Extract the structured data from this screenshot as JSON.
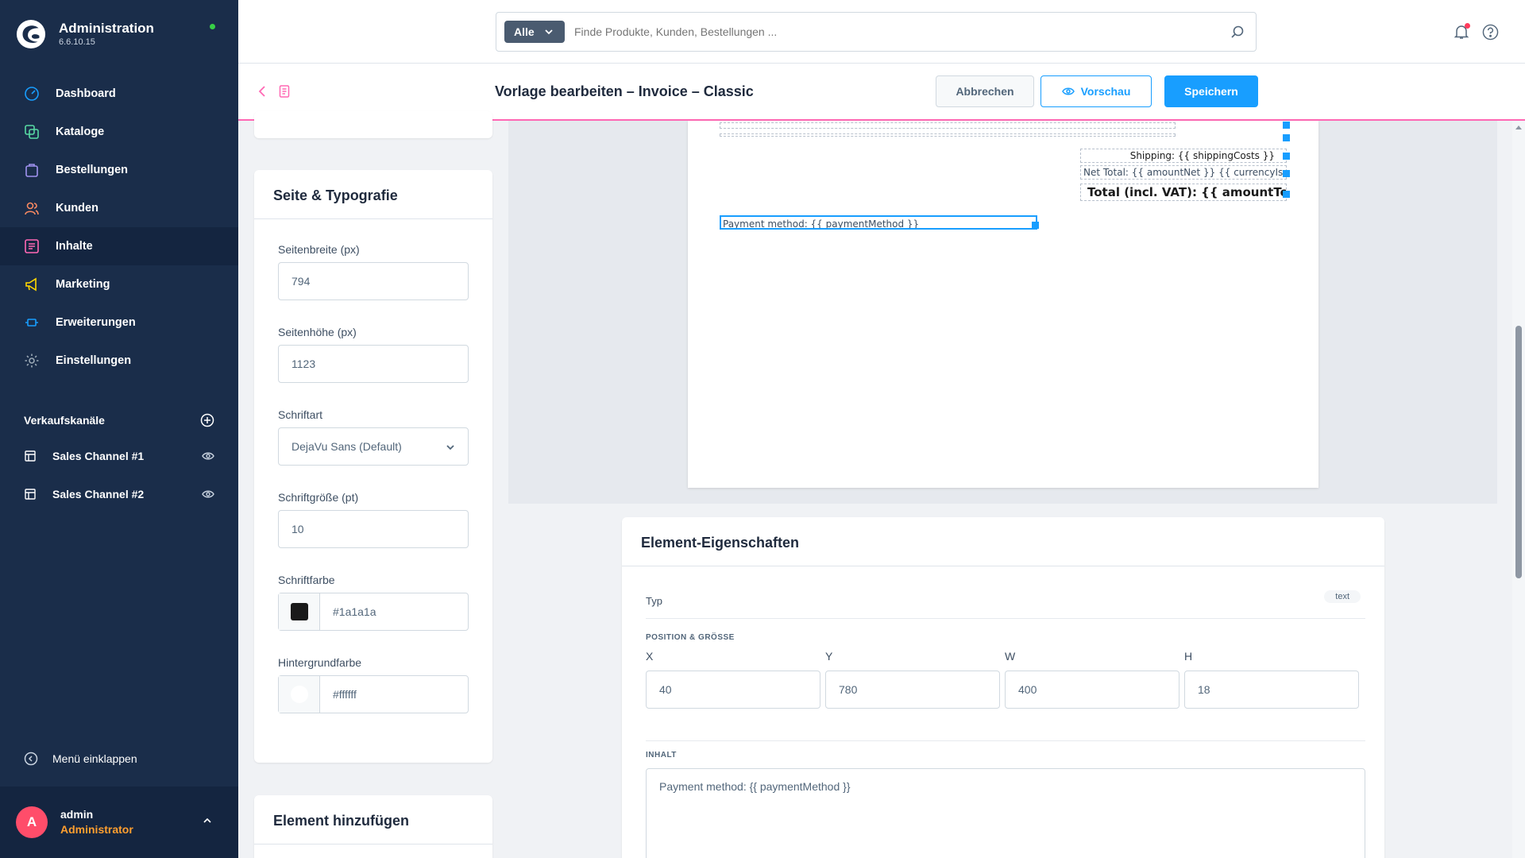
{
  "app": {
    "title": "Administration",
    "version": "6.6.10.15"
  },
  "nav": [
    {
      "label": "Dashboard",
      "icon": "dashboard-icon",
      "active": false
    },
    {
      "label": "Kataloge",
      "icon": "catalog-icon",
      "active": false
    },
    {
      "label": "Bestellungen",
      "icon": "orders-icon",
      "active": false
    },
    {
      "label": "Kunden",
      "icon": "customers-icon",
      "active": false
    },
    {
      "label": "Inhalte",
      "icon": "content-icon",
      "active": true
    },
    {
      "label": "Marketing",
      "icon": "marketing-icon",
      "active": false
    },
    {
      "label": "Erweiterungen",
      "icon": "extensions-icon",
      "active": false
    },
    {
      "label": "Einstellungen",
      "icon": "settings-icon",
      "active": false
    }
  ],
  "sales_channels": {
    "title": "Verkaufskanäle",
    "items": [
      {
        "label": "Sales Channel #1"
      },
      {
        "label": "Sales Channel #2"
      }
    ]
  },
  "collapse_label": "Menü einklappen",
  "user": {
    "initial": "A",
    "name": "admin",
    "role": "Administrator"
  },
  "search": {
    "filter_label": "Alle",
    "placeholder": "Finde Produkte, Kunden, Bestellungen ..."
  },
  "smartbar": {
    "title": "Vorlage bearbeiten – Invoice – Classic",
    "cancel_label": "Abbrechen",
    "preview_label": "Vorschau",
    "save_label": "Speichern"
  },
  "typography": {
    "title": "Seite & Typografie",
    "page_width_label": "Seitenbreite (px)",
    "page_width": "794",
    "page_height_label": "Seitenhöhe (px)",
    "page_height": "1123",
    "font_label": "Schriftart",
    "font_value": "DejaVu Sans (Default)",
    "font_size_label": "Schriftgröße (pt)",
    "font_size": "10",
    "font_color_label": "Schriftfarbe",
    "font_color": "#1a1a1a",
    "bg_color_label": "Hintergrundfarbe",
    "bg_color": "#ffffff"
  },
  "add_element": {
    "title": "Element hinzufügen"
  },
  "canvas": {
    "elements": [
      {
        "text": "Shipping: {{ shippingCosts }}"
      },
      {
        "text": "Net Total: {{ amountNet }} {{ currencyIsoCode }}"
      },
      {
        "text": "Total (incl. VAT): {{ amountTotal }}"
      },
      {
        "text": "Payment method: {{ paymentMethod }}"
      }
    ]
  },
  "properties": {
    "title": "Element-Eigenschaften",
    "type_label": "Typ",
    "type_value": "text",
    "position_caption": "POSITION & GRÖSSE",
    "x_label": "X",
    "x": "40",
    "y_label": "Y",
    "y": "780",
    "w_label": "W",
    "w": "400",
    "h_label": "H",
    "h": "18",
    "content_caption": "INHALT",
    "content": "Payment method: {{ paymentMethod }}"
  },
  "colors": {
    "accent": "#189eff",
    "sidebar": "#1a2d4a",
    "smartbar_border": "#ff68b4",
    "user_role": "#ff9f2f"
  }
}
